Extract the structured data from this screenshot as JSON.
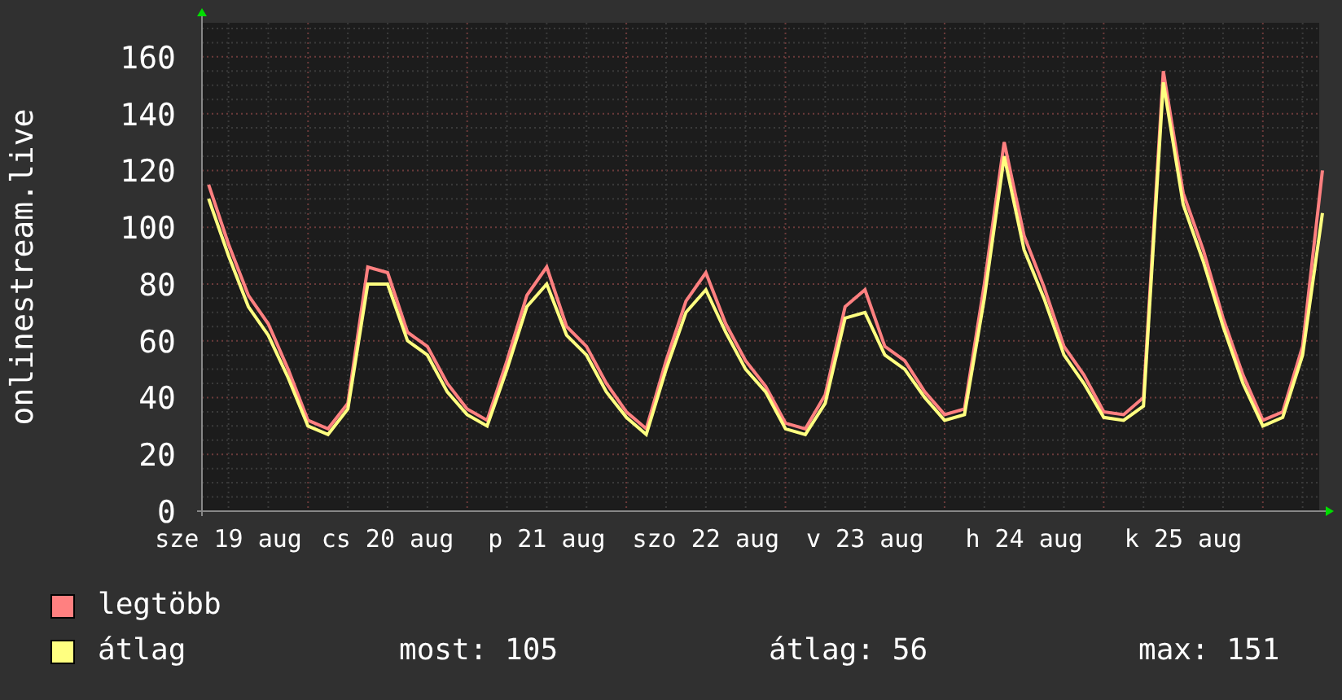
{
  "chart": {
    "chart_data": {
      "type": "line",
      "ylabel": "onlinestream.live",
      "categories": [
        null,
        "sze 19 aug",
        null,
        null,
        null,
        null,
        null,
        null,
        null,
        "cs 20 aug",
        null,
        null,
        null,
        null,
        null,
        null,
        null,
        "p 21 aug",
        null,
        null,
        null,
        null,
        null,
        null,
        null,
        "szo 22 aug",
        null,
        null,
        null,
        null,
        null,
        null,
        null,
        "v 23 aug",
        null,
        null,
        null,
        null,
        null,
        null,
        null,
        "h 24 aug",
        null,
        null,
        null,
        null,
        null,
        null,
        null,
        "k 25 aug",
        null,
        null,
        null,
        null,
        null,
        null,
        null
      ],
      "series": [
        {
          "name": "legtöbb",
          "color": "#ff8080",
          "values": [
            115,
            94,
            76,
            66,
            50,
            32,
            29,
            38,
            86,
            84,
            63,
            58,
            45,
            36,
            32,
            53,
            76,
            86,
            65,
            58,
            45,
            35,
            29,
            53,
            74,
            84,
            66,
            53,
            44,
            31,
            29,
            41,
            72,
            78,
            58,
            53,
            42,
            34,
            36,
            80,
            130,
            97,
            79,
            58,
            48,
            35,
            34,
            40,
            155,
            112,
            92,
            68,
            48,
            32,
            35,
            58,
            120
          ]
        },
        {
          "name": "átlag",
          "color": "#ffff80",
          "values": [
            110,
            90,
            72,
            62,
            47,
            30,
            27,
            36,
            80,
            80,
            60,
            55,
            42,
            34,
            30,
            50,
            72,
            80,
            62,
            55,
            42,
            33,
            27,
            50,
            70,
            78,
            63,
            50,
            42,
            29,
            27,
            38,
            68,
            70,
            55,
            50,
            40,
            32,
            34,
            75,
            125,
            92,
            75,
            55,
            45,
            33,
            32,
            37,
            151,
            108,
            88,
            65,
            45,
            30,
            33,
            55,
            105
          ]
        }
      ],
      "grid": true,
      "ylim": [
        0,
        172
      ],
      "yticks": [
        0,
        20,
        40,
        60,
        80,
        100,
        120,
        140,
        160
      ]
    }
  },
  "legend": [
    {
      "stats": [
        "most: 105",
        "átlag: 56",
        "max: 151"
      ]
    }
  ]
}
